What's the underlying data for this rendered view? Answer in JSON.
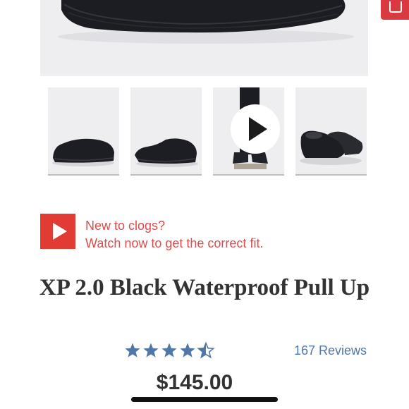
{
  "product": {
    "title": "XP 2.0 Black Waterproof Pull Up",
    "price": "$145.00",
    "rating": 4.5,
    "rating_max": 5,
    "reviews_label": "167 Reviews"
  },
  "media": {
    "main_image": "shoe-black-side-view",
    "thumbnails": [
      {
        "icon": "clog-side-view-thumbnail"
      },
      {
        "icon": "clog-side-view-alt-thumbnail"
      },
      {
        "icon": "video-thumbnail",
        "overlay": "play-icon"
      },
      {
        "icon": "clog-pair-thumbnail"
      }
    ]
  },
  "fit_video": {
    "icon": "play-icon",
    "line1": "New to clogs?",
    "line2": "Watch now to get the correct fit."
  },
  "colors": {
    "accent_red": "#e13b33",
    "link_red": "#e04b4b",
    "link_blue": "#4f78a8",
    "star_blue": "#4f78a8",
    "image_bg": "#eeeef0"
  }
}
